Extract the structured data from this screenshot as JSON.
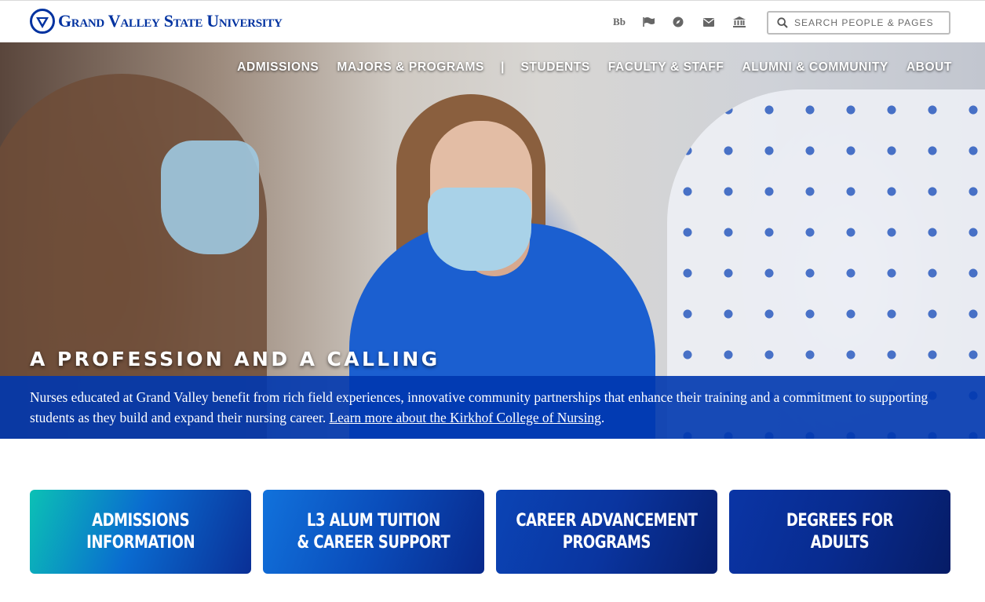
{
  "header": {
    "logo_text": "Grand Valley State University",
    "logo_icon": "gvsu-logo-icon",
    "utility_icons": [
      "blackboard-icon",
      "flag-icon",
      "compass-icon",
      "mail-icon",
      "bank-icon"
    ],
    "blackboard_label": "Bb",
    "search": {
      "placeholder": "Search People & Pages",
      "value": ""
    }
  },
  "nav": {
    "items": [
      "Admissions",
      "Majors & Programs",
      "Students",
      "Faculty & Staff",
      "Alumni & Community",
      "About"
    ],
    "separator": "|"
  },
  "hero": {
    "headline": "A Profession and a Calling",
    "caption": "Nurses educated at Grand Valley benefit from rich field experiences, innovative community partnerships that enhance their training and a commitment to supporting students as they build and expand their nursing career. ",
    "link_text": "Learn more about the Kirkhof College of Nursing",
    "caption_end": "."
  },
  "cards": [
    "Admissions\nInformation",
    "L3 Alum Tuition\n& Career Support",
    "Career Advancement\nPrograms",
    "Degrees for\nAdults"
  ],
  "colors": {
    "brand_blue": "#0032a0",
    "caption_bar": "#0037af",
    "card_teal": "#0bc1b5",
    "card_navy": "#061c66"
  }
}
